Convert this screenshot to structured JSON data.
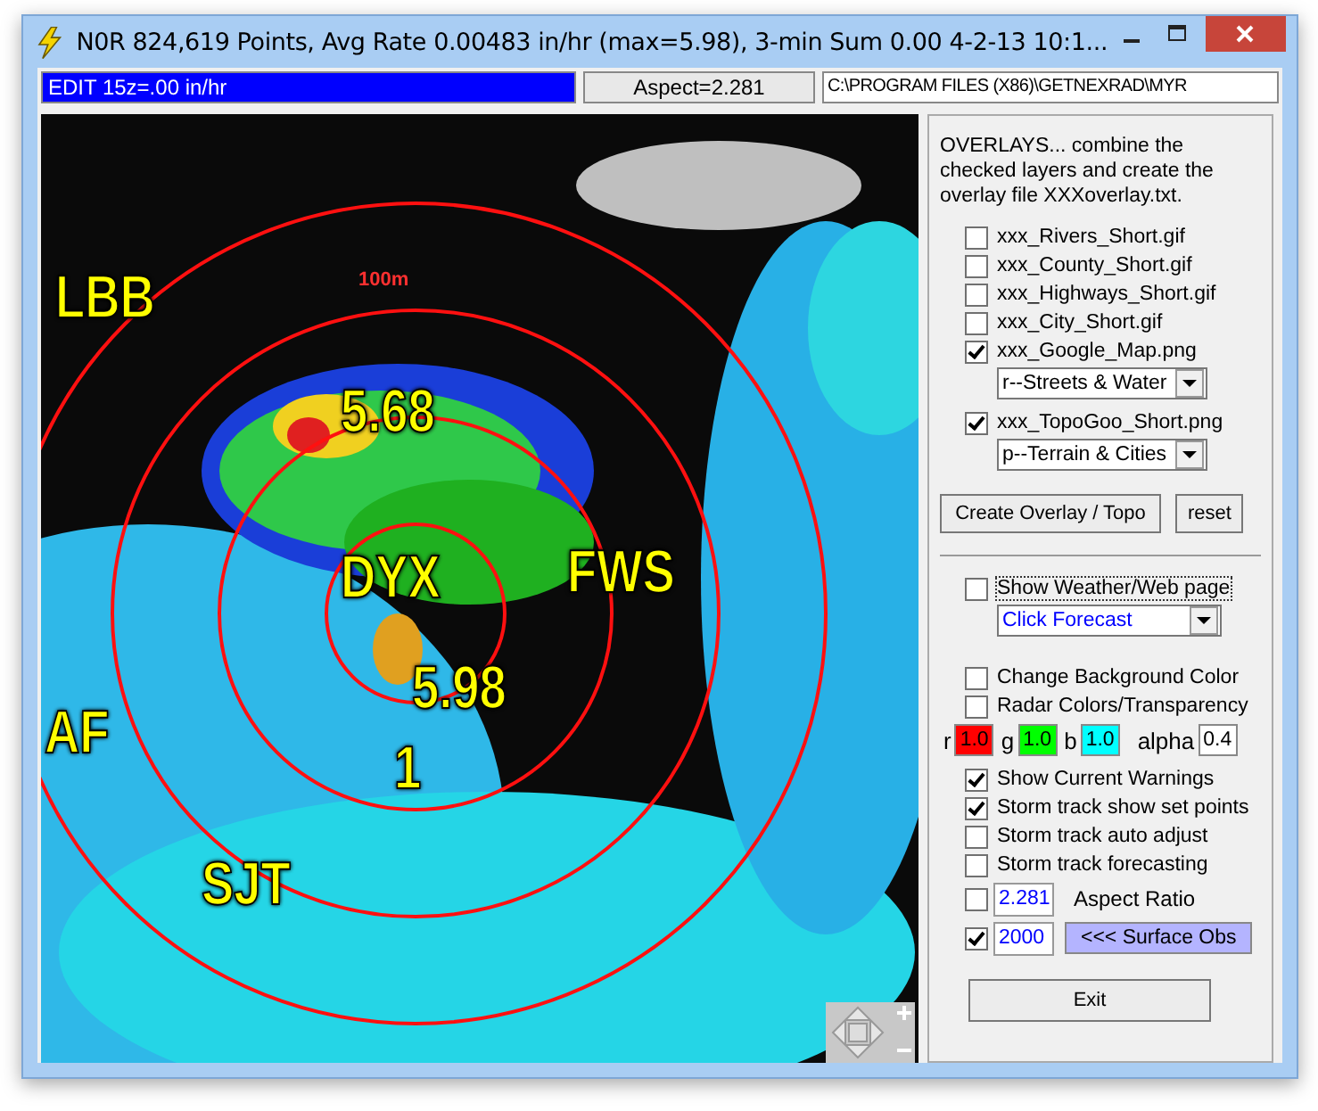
{
  "window": {
    "title": "N0R 824,619 Points, Avg Rate 0.00483 in/hr (max=5.98), 3-min Sum 0.00  4-2-13 10:1..."
  },
  "status": {
    "edit": "EDIT 15z=.00 in/hr",
    "aspect": "Aspect=2.281",
    "path": "C:\\PROGRAM FILES (X86)\\GETNEXRAD\\MYR"
  },
  "map": {
    "labels": [
      {
        "text": "LBB",
        "kind": "station"
      },
      {
        "text": "100m",
        "kind": "range"
      },
      {
        "text": "5.68",
        "kind": "value"
      },
      {
        "text": "DYX",
        "kind": "station"
      },
      {
        "text": "FWS",
        "kind": "station"
      },
      {
        "text": "5.98",
        "kind": "value"
      },
      {
        "text": "1",
        "kind": "value"
      },
      {
        "text": "AF",
        "kind": "station"
      },
      {
        "text": "SJT",
        "kind": "station"
      }
    ]
  },
  "panel": {
    "intro": "OVERLAYS...  combine the checked layers and create the overlay file XXXoverlay.txt.",
    "layers": [
      {
        "label": "xxx_Rivers_Short.gif",
        "checked": false
      },
      {
        "label": "xxx_County_Short.gif",
        "checked": false
      },
      {
        "label": "xxx_Highways_Short.gif",
        "checked": false
      },
      {
        "label": "xxx_City_Short.gif",
        "checked": false
      },
      {
        "label": "xxx_Google_Map.png",
        "checked": true,
        "dropdown": "r--Streets & Water"
      },
      {
        "label": "xxx_TopoGoo_Short.png",
        "checked": true,
        "dropdown": "p--Terrain & Cities"
      }
    ],
    "buttons": [
      "Create Overlay / Topo",
      "reset"
    ],
    "web": {
      "label": "Show Weather/Web page",
      "checked": false,
      "dropdown": "Click Forecast"
    },
    "options": [
      {
        "label": "Change Background Color",
        "checked": false
      },
      {
        "label": "Radar Colors/Transparency",
        "checked": false
      }
    ],
    "colors": [
      {
        "label": "r",
        "value": "1.0",
        "color": "#ff0000"
      },
      {
        "label": "g",
        "value": "1.0",
        "color": "#00ff00"
      },
      {
        "label": "b",
        "value": "1.0",
        "color": "#00ffff"
      },
      {
        "label": "alpha",
        "value": "0.4",
        "color": "#ffffff"
      }
    ],
    "tracks": [
      {
        "label": "Show Current Warnings",
        "checked": true
      },
      {
        "label": "Storm track show set points",
        "checked": true
      },
      {
        "label": "Storm track auto adjust",
        "checked": false
      },
      {
        "label": "Storm track forecasting",
        "checked": false
      }
    ],
    "aspect": {
      "checked": false,
      "value": "2.281",
      "label": "Aspect Ratio"
    },
    "surface": {
      "checked": true,
      "value": "2000",
      "button": "<<< Surface Obs"
    },
    "exit": "Exit"
  }
}
